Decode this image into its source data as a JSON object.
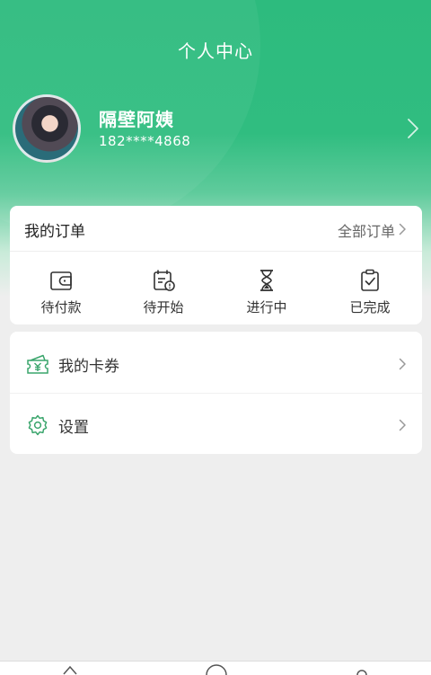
{
  "header": {
    "title": "个人中心"
  },
  "profile": {
    "name": "隔壁阿姨",
    "phone": "182****4868"
  },
  "orders": {
    "title": "我的订单",
    "view_all": "全部订单",
    "statuses": [
      {
        "label": "待付款",
        "icon": "wallet-icon"
      },
      {
        "label": "待开始",
        "icon": "calendar-clock-icon"
      },
      {
        "label": "进行中",
        "icon": "hourglass-icon"
      },
      {
        "label": "已完成",
        "icon": "clipboard-check-icon"
      }
    ]
  },
  "menu": [
    {
      "label": "我的卡券",
      "icon": "coupon-icon"
    },
    {
      "label": "设置",
      "icon": "settings-icon"
    }
  ],
  "tabbar": {
    "icons": [
      "home-icon",
      "discover-icon",
      "profile-icon"
    ]
  },
  "colors": {
    "primary": "#2dbb7e",
    "icon_green": "#3aa56c",
    "background": "#eeeeee"
  }
}
